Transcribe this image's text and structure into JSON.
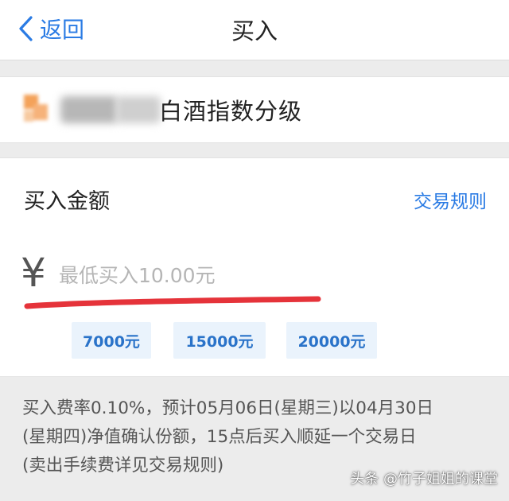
{
  "nav": {
    "back_label": "返回",
    "title": "买入"
  },
  "fund": {
    "name_visible": "白酒指数分级"
  },
  "buy": {
    "section_title": "买入金额",
    "rules_link": "交易规则",
    "currency_symbol": "¥",
    "amount_value": "",
    "amount_placeholder": "最低买入10.00元",
    "quick_amounts": [
      "7000元",
      "15000元",
      "20000元"
    ]
  },
  "note": {
    "lines": [
      "买入费率0.10%，预计05月06日(星期三)以04月30日",
      "(星期四)净值确认份额，15点后买入顺延一个交易日",
      "(卖出手续费详见交易规则)"
    ]
  },
  "watermark": "头条 @竹子姐姐的课堂",
  "colors": {
    "accent": "#2a7be4",
    "annotation": "#e5333a",
    "quick_bg": "#eaf3fc"
  }
}
